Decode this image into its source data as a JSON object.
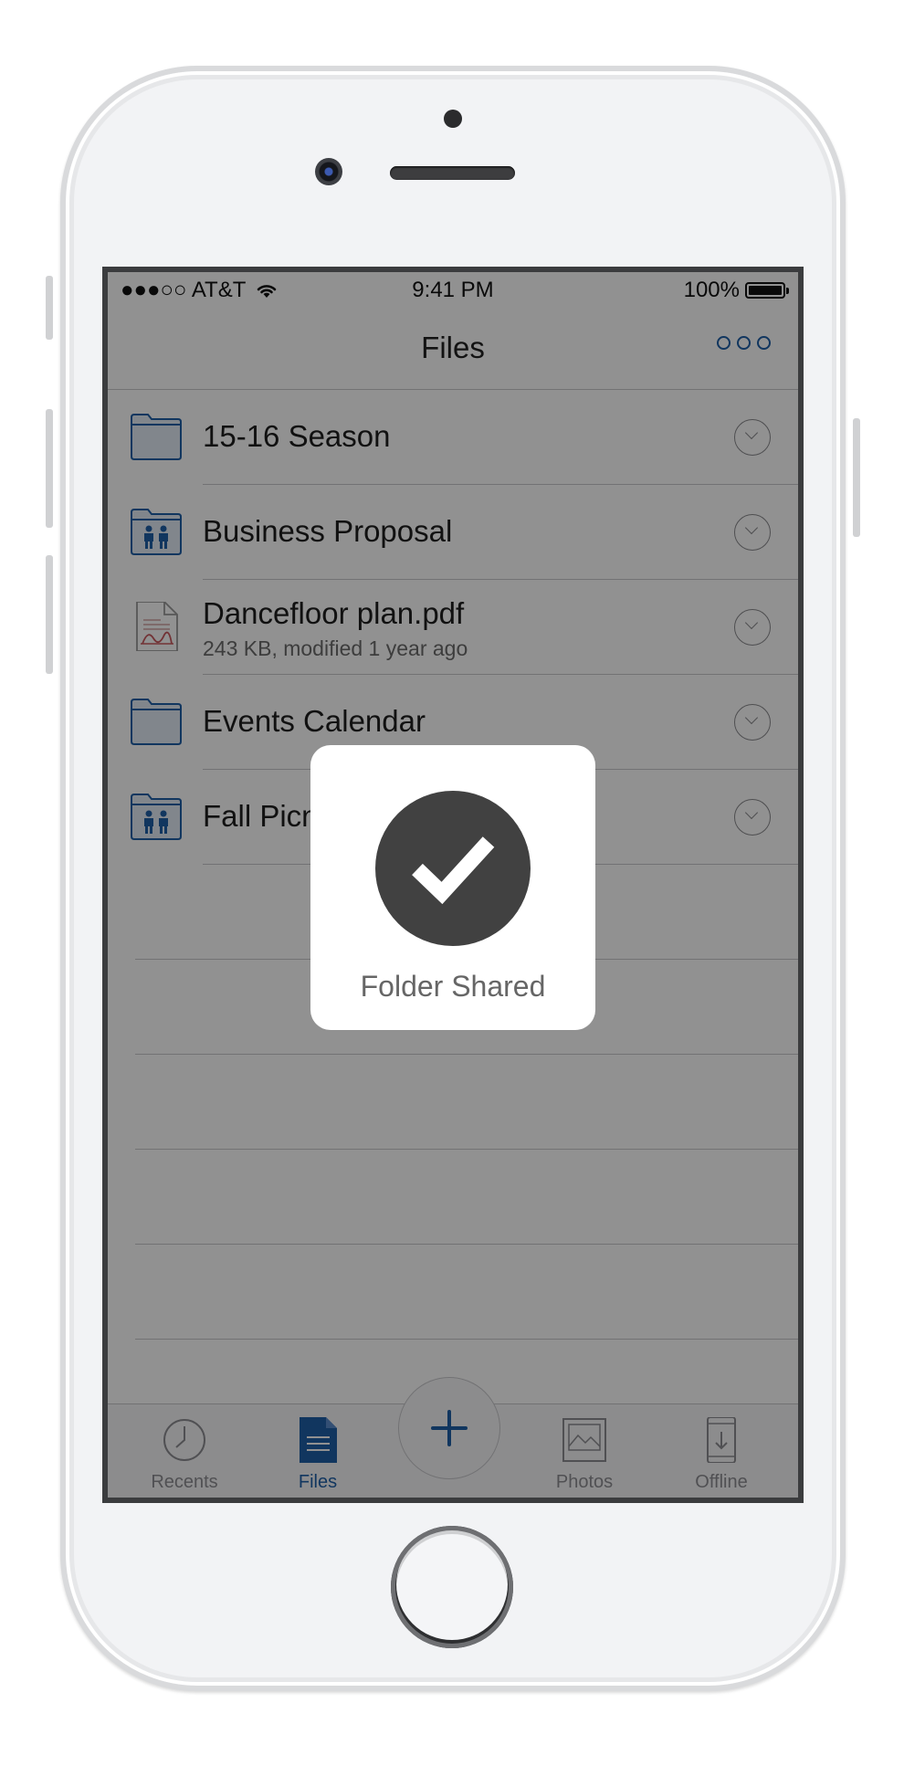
{
  "status_bar": {
    "carrier": "●●●○○ AT&T",
    "time": "9:41 PM",
    "battery": "100%"
  },
  "nav": {
    "title": "Files",
    "more_icon": "more-horizontal-icon"
  },
  "files": [
    {
      "name": "15-16 Season",
      "meta": "",
      "type": "folder"
    },
    {
      "name": "Business Proposal",
      "meta": "",
      "type": "shared-folder"
    },
    {
      "name": "Dancefloor plan.pdf",
      "meta": "243 KB, modified 1 year ago",
      "type": "pdf"
    },
    {
      "name": "Events Calendar",
      "meta": "",
      "type": "folder"
    },
    {
      "name": "Fall Picnic",
      "meta": "",
      "type": "shared-folder"
    }
  ],
  "tabs": [
    {
      "label": "Recents",
      "icon": "clock-icon",
      "active": false
    },
    {
      "label": "Files",
      "icon": "document-icon",
      "active": true
    },
    {
      "label": "Photos",
      "icon": "photo-icon",
      "active": false
    },
    {
      "label": "Offline",
      "icon": "offline-device-icon",
      "active": false
    }
  ],
  "fab": {
    "icon": "plus-icon"
  },
  "toast": {
    "label": "Folder Shared",
    "icon": "checkmark-icon"
  },
  "colors": {
    "accent": "#1f5fa8",
    "overlay": "rgba(0,0,0,0.43)",
    "toast_circle": "#414141"
  }
}
